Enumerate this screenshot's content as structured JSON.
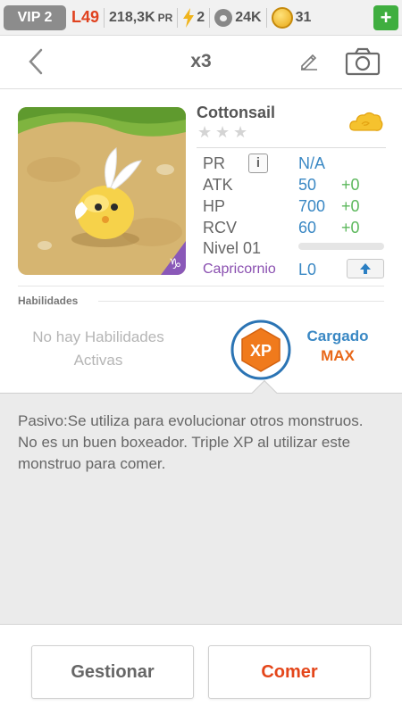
{
  "status_bar": {
    "vip": "VIP 2",
    "player_level": "L49",
    "power": "218,3K",
    "power_unit": "PR",
    "energy": "2",
    "food": "24K",
    "coins": "31",
    "add_label": "+"
  },
  "header": {
    "count": "x3"
  },
  "monster": {
    "name": "Cottonsail",
    "stars": [
      "★",
      "★",
      "★"
    ],
    "stats": {
      "pr_label": "PR",
      "pr_info": "i",
      "pr_value": "N/A",
      "atk_label": "ATK",
      "atk_value": "50",
      "atk_bonus": "+0",
      "hp_label": "HP",
      "hp_value": "700",
      "hp_bonus": "+0",
      "rcv_label": "RCV",
      "rcv_value": "60",
      "rcv_bonus": "+0",
      "level_label": "Nivel 01",
      "level_progress": 0
    },
    "zodiac": "Capricornio",
    "zodiac_level": "L0"
  },
  "skills": {
    "section_label": "Habilidades",
    "empty_text": "No hay Habilidades Activas",
    "charge_label": "Cargado",
    "charge_value": "MAX",
    "badge_text": "XP"
  },
  "description": "Pasivo:Se utiliza para evolucionar otros monstruos. No es un buen boxeador. Triple XP al utilizar este monstruo para comer.",
  "actions": {
    "manage_label": "Gestionar",
    "eat_label": "Comer"
  },
  "colors": {
    "accent_blue": "#3a88c4",
    "accent_orange": "#e8681a",
    "bonus_green": "#5cb85c",
    "zodiac_purple": "#8a4fb0",
    "level_red": "#e0421f"
  }
}
